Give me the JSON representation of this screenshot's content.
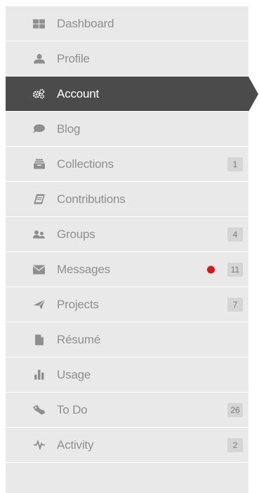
{
  "colors": {
    "sidebar_bg": "#e9e9e9",
    "active_bg": "#4b4b4b",
    "text": "#8f8f8f",
    "active_text": "#ffffff",
    "badge_bg": "#d5d5d5",
    "alert_dot": "#d9161b"
  },
  "sidebar": {
    "items": [
      {
        "label": "Dashboard",
        "icon": "dashboard-grid-icon"
      },
      {
        "label": "Profile",
        "icon": "user-icon"
      },
      {
        "label": "Account",
        "icon": "cogs-icon",
        "active": true
      },
      {
        "label": "Blog",
        "icon": "comment-icon"
      },
      {
        "label": "Collections",
        "icon": "inbox-icon",
        "badge": "1"
      },
      {
        "label": "Contributions",
        "icon": "book-icon"
      },
      {
        "label": "Groups",
        "icon": "group-icon",
        "badge": "4"
      },
      {
        "label": "Messages",
        "icon": "envelope-icon",
        "badge": "11",
        "alert": true
      },
      {
        "label": "Projects",
        "icon": "paper-plane-icon",
        "badge": "7"
      },
      {
        "label": "Résumé",
        "icon": "file-icon"
      },
      {
        "label": "Usage",
        "icon": "bar-chart-icon"
      },
      {
        "label": "To Do",
        "icon": "tasks-icon",
        "badge": "26"
      },
      {
        "label": "Activity",
        "icon": "activity-pulse-icon",
        "badge": "2"
      }
    ]
  }
}
